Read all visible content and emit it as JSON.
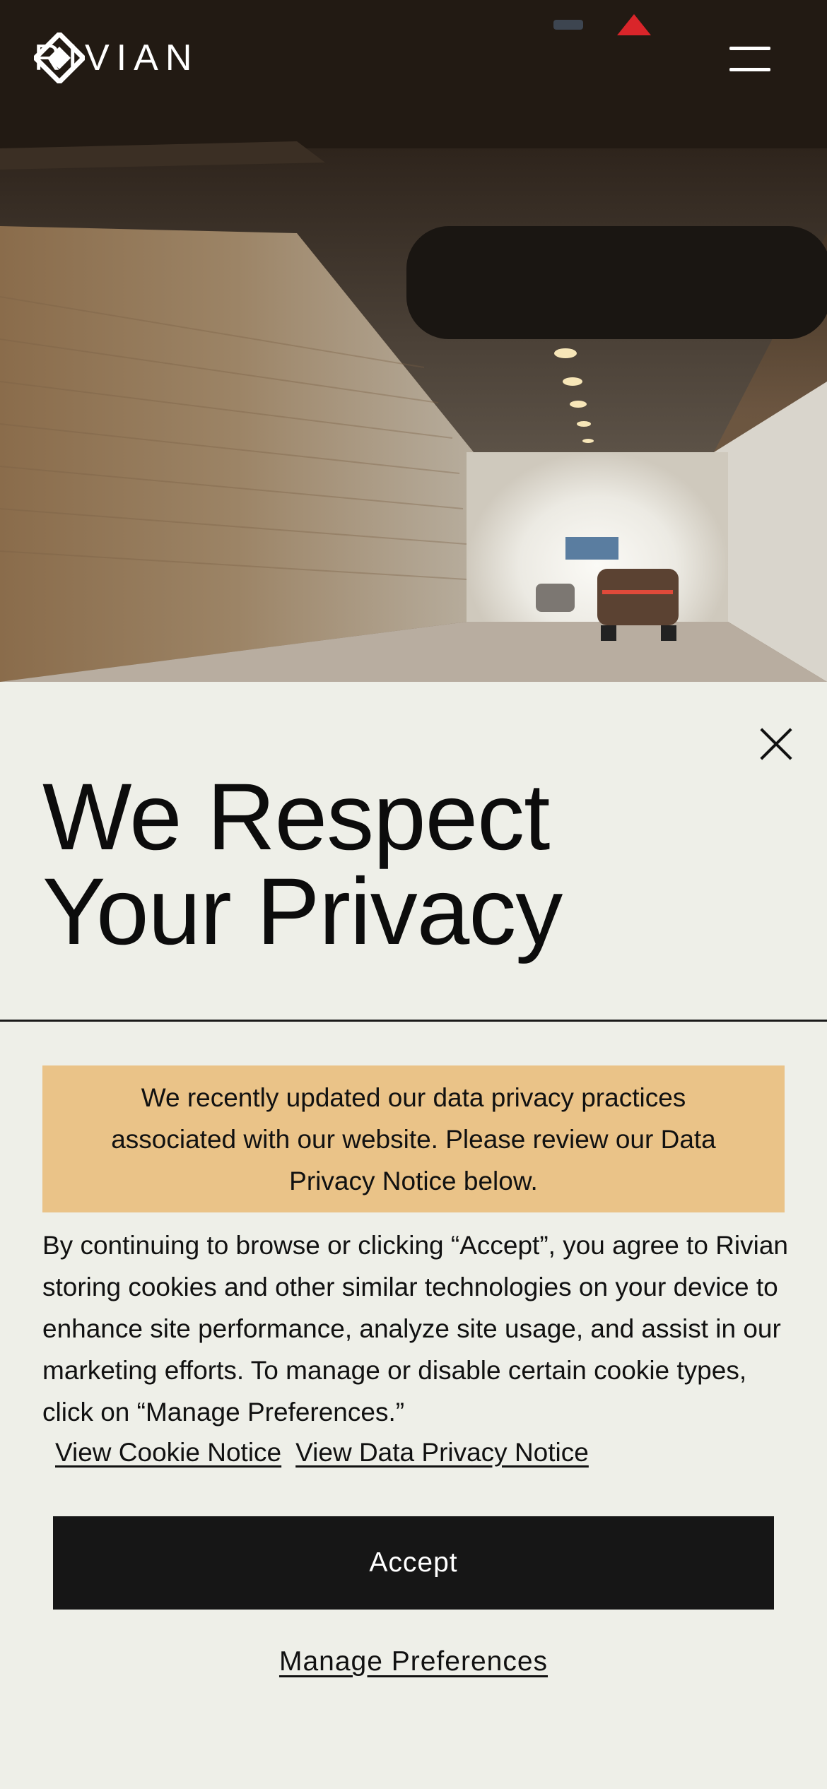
{
  "header": {
    "logo_text": "RIVIAN",
    "logo_icon": "rivian-compass-icon",
    "menu_icon": "hamburger-menu-icon"
  },
  "hero": {
    "image": "road-tunnel-driving-photo"
  },
  "privacy_modal": {
    "close_icon": "close-icon",
    "title_line1": "We Respect",
    "title_line2": "Your Privacy",
    "notice_text": "We recently updated our data privacy practices associated with our website. Please review our Data Privacy Notice below.",
    "body_text": "By continuing to browse or clicking “Accept”, you agree to Rivian storing cookies and other similar technologies on your device to enhance site performance, analyze site usage, and assist in our marketing efforts. To manage or disable certain cookie types, click on “Manage Preferences.”",
    "cookie_notice_link": "View Cookie Notice",
    "data_privacy_link": "View Data Privacy Notice",
    "accept_label": "Accept",
    "manage_label": "Manage Preferences"
  },
  "colors": {
    "panel_bg": "#eeefe8",
    "notice_bg": "#eac388",
    "button_bg": "#161616"
  }
}
